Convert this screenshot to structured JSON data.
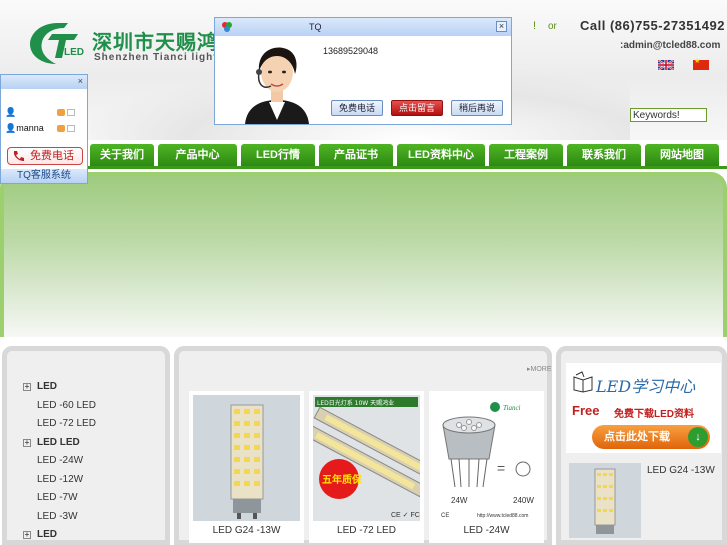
{
  "header": {
    "logo_cn": "深圳市天赐鸿业",
    "logo_en": "Shenzhen Tianci lighting",
    "logo_badge": "LED",
    "lang_bang": "!",
    "lang_or": "or",
    "call": "Call  (86)755-27351492",
    "email": ":admin@tcled88.com",
    "search_value": "Keywords!"
  },
  "nav": {
    "items": [
      "关于我们",
      "产品中心",
      "LED行情",
      "产品证书",
      "LED资料中心",
      "工程案例",
      "联系我们",
      "网站地图"
    ]
  },
  "categories": [
    {
      "label": "LED",
      "level": "top"
    },
    {
      "label": "LED   -60 LED",
      "level": "sub"
    },
    {
      "label": "LED   -72 LED",
      "level": "sub"
    },
    {
      "label": "LED      LED",
      "level": "top"
    },
    {
      "label": "LED   -24W",
      "level": "sub"
    },
    {
      "label": "LED   -12W",
      "level": "sub"
    },
    {
      "label": "LED   -7W",
      "level": "sub"
    },
    {
      "label": "LED   -3W",
      "level": "sub"
    },
    {
      "label": "LED",
      "level": "top"
    }
  ],
  "products": {
    "more_label": "MORE",
    "items": [
      {
        "caption": "LED G24   -13W",
        "badge": ""
      },
      {
        "caption": "LED   -72 LED",
        "badge": "五年质保",
        "tag": "LED日光灯系 10W 天赐鸿业"
      },
      {
        "caption": "LED   -24W",
        "badge": "",
        "brand": "Tianci",
        "watt_a": "24W",
        "watt_b": "240W",
        "url": "http://www.tcled88.com"
      }
    ]
  },
  "learning": {
    "title": "LED学习中心",
    "free": "Free",
    "subtitle": "免费下载LED资料",
    "button": "点击此处下载",
    "side_caption": "LED G24   -13W"
  },
  "tq_popup": {
    "title": "TQ",
    "qq": "13689529048",
    "btn_call": "免费电话",
    "btn_message": "点击留言",
    "btn_later": "稍后再说"
  },
  "left_widget": {
    "user1": "",
    "user2": "manna",
    "call": "免费电话",
    "footer": "TQ客服系统"
  },
  "colors": {
    "nav_green": "#3b9a1a",
    "brand_green": "#1f8f4a",
    "popup_blue": "#7ba7d9",
    "accent_red": "#c02020"
  }
}
